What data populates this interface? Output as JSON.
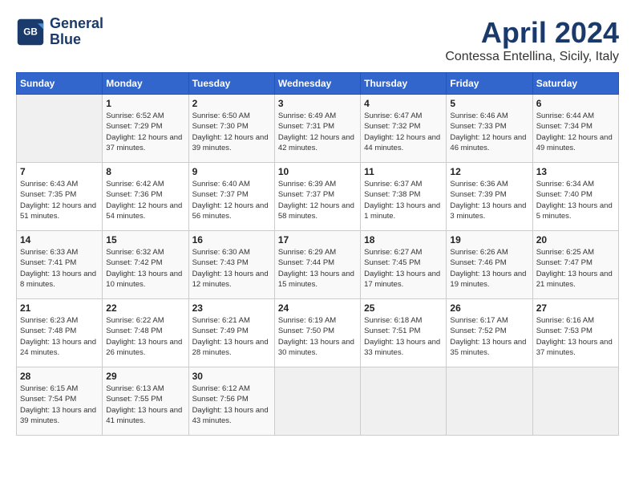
{
  "header": {
    "logo_line1": "General",
    "logo_line2": "Blue",
    "month_title": "April 2024",
    "subtitle": "Contessa Entellina, Sicily, Italy"
  },
  "weekdays": [
    "Sunday",
    "Monday",
    "Tuesday",
    "Wednesday",
    "Thursday",
    "Friday",
    "Saturday"
  ],
  "weeks": [
    [
      null,
      {
        "num": "1",
        "sunrise": "Sunrise: 6:52 AM",
        "sunset": "Sunset: 7:29 PM",
        "daylight": "Daylight: 12 hours and 37 minutes."
      },
      {
        "num": "2",
        "sunrise": "Sunrise: 6:50 AM",
        "sunset": "Sunset: 7:30 PM",
        "daylight": "Daylight: 12 hours and 39 minutes."
      },
      {
        "num": "3",
        "sunrise": "Sunrise: 6:49 AM",
        "sunset": "Sunset: 7:31 PM",
        "daylight": "Daylight: 12 hours and 42 minutes."
      },
      {
        "num": "4",
        "sunrise": "Sunrise: 6:47 AM",
        "sunset": "Sunset: 7:32 PM",
        "daylight": "Daylight: 12 hours and 44 minutes."
      },
      {
        "num": "5",
        "sunrise": "Sunrise: 6:46 AM",
        "sunset": "Sunset: 7:33 PM",
        "daylight": "Daylight: 12 hours and 46 minutes."
      },
      {
        "num": "6",
        "sunrise": "Sunrise: 6:44 AM",
        "sunset": "Sunset: 7:34 PM",
        "daylight": "Daylight: 12 hours and 49 minutes."
      }
    ],
    [
      {
        "num": "7",
        "sunrise": "Sunrise: 6:43 AM",
        "sunset": "Sunset: 7:35 PM",
        "daylight": "Daylight: 12 hours and 51 minutes."
      },
      {
        "num": "8",
        "sunrise": "Sunrise: 6:42 AM",
        "sunset": "Sunset: 7:36 PM",
        "daylight": "Daylight: 12 hours and 54 minutes."
      },
      {
        "num": "9",
        "sunrise": "Sunrise: 6:40 AM",
        "sunset": "Sunset: 7:37 PM",
        "daylight": "Daylight: 12 hours and 56 minutes."
      },
      {
        "num": "10",
        "sunrise": "Sunrise: 6:39 AM",
        "sunset": "Sunset: 7:37 PM",
        "daylight": "Daylight: 12 hours and 58 minutes."
      },
      {
        "num": "11",
        "sunrise": "Sunrise: 6:37 AM",
        "sunset": "Sunset: 7:38 PM",
        "daylight": "Daylight: 13 hours and 1 minute."
      },
      {
        "num": "12",
        "sunrise": "Sunrise: 6:36 AM",
        "sunset": "Sunset: 7:39 PM",
        "daylight": "Daylight: 13 hours and 3 minutes."
      },
      {
        "num": "13",
        "sunrise": "Sunrise: 6:34 AM",
        "sunset": "Sunset: 7:40 PM",
        "daylight": "Daylight: 13 hours and 5 minutes."
      }
    ],
    [
      {
        "num": "14",
        "sunrise": "Sunrise: 6:33 AM",
        "sunset": "Sunset: 7:41 PM",
        "daylight": "Daylight: 13 hours and 8 minutes."
      },
      {
        "num": "15",
        "sunrise": "Sunrise: 6:32 AM",
        "sunset": "Sunset: 7:42 PM",
        "daylight": "Daylight: 13 hours and 10 minutes."
      },
      {
        "num": "16",
        "sunrise": "Sunrise: 6:30 AM",
        "sunset": "Sunset: 7:43 PM",
        "daylight": "Daylight: 13 hours and 12 minutes."
      },
      {
        "num": "17",
        "sunrise": "Sunrise: 6:29 AM",
        "sunset": "Sunset: 7:44 PM",
        "daylight": "Daylight: 13 hours and 15 minutes."
      },
      {
        "num": "18",
        "sunrise": "Sunrise: 6:27 AM",
        "sunset": "Sunset: 7:45 PM",
        "daylight": "Daylight: 13 hours and 17 minutes."
      },
      {
        "num": "19",
        "sunrise": "Sunrise: 6:26 AM",
        "sunset": "Sunset: 7:46 PM",
        "daylight": "Daylight: 13 hours and 19 minutes."
      },
      {
        "num": "20",
        "sunrise": "Sunrise: 6:25 AM",
        "sunset": "Sunset: 7:47 PM",
        "daylight": "Daylight: 13 hours and 21 minutes."
      }
    ],
    [
      {
        "num": "21",
        "sunrise": "Sunrise: 6:23 AM",
        "sunset": "Sunset: 7:48 PM",
        "daylight": "Daylight: 13 hours and 24 minutes."
      },
      {
        "num": "22",
        "sunrise": "Sunrise: 6:22 AM",
        "sunset": "Sunset: 7:48 PM",
        "daylight": "Daylight: 13 hours and 26 minutes."
      },
      {
        "num": "23",
        "sunrise": "Sunrise: 6:21 AM",
        "sunset": "Sunset: 7:49 PM",
        "daylight": "Daylight: 13 hours and 28 minutes."
      },
      {
        "num": "24",
        "sunrise": "Sunrise: 6:19 AM",
        "sunset": "Sunset: 7:50 PM",
        "daylight": "Daylight: 13 hours and 30 minutes."
      },
      {
        "num": "25",
        "sunrise": "Sunrise: 6:18 AM",
        "sunset": "Sunset: 7:51 PM",
        "daylight": "Daylight: 13 hours and 33 minutes."
      },
      {
        "num": "26",
        "sunrise": "Sunrise: 6:17 AM",
        "sunset": "Sunset: 7:52 PM",
        "daylight": "Daylight: 13 hours and 35 minutes."
      },
      {
        "num": "27",
        "sunrise": "Sunrise: 6:16 AM",
        "sunset": "Sunset: 7:53 PM",
        "daylight": "Daylight: 13 hours and 37 minutes."
      }
    ],
    [
      {
        "num": "28",
        "sunrise": "Sunrise: 6:15 AM",
        "sunset": "Sunset: 7:54 PM",
        "daylight": "Daylight: 13 hours and 39 minutes."
      },
      {
        "num": "29",
        "sunrise": "Sunrise: 6:13 AM",
        "sunset": "Sunset: 7:55 PM",
        "daylight": "Daylight: 13 hours and 41 minutes."
      },
      {
        "num": "30",
        "sunrise": "Sunrise: 6:12 AM",
        "sunset": "Sunset: 7:56 PM",
        "daylight": "Daylight: 13 hours and 43 minutes."
      },
      null,
      null,
      null,
      null
    ]
  ]
}
